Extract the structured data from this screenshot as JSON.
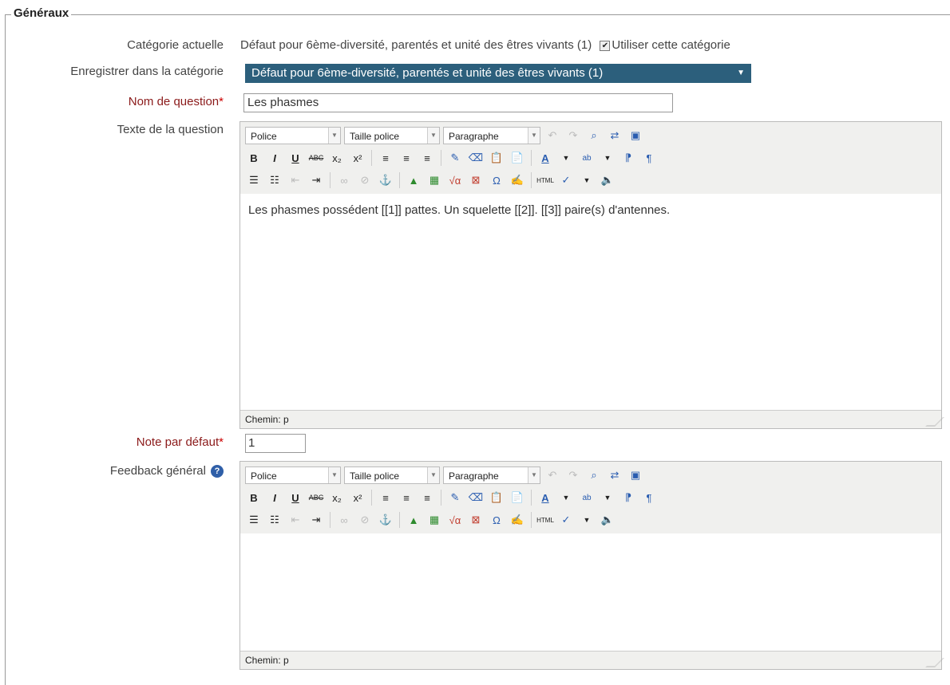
{
  "section": {
    "legend": "Généraux"
  },
  "labels": {
    "current_category": "Catégorie actuelle",
    "save_in_category": "Enregistrer dans la catégorie",
    "question_name": "Nom de question",
    "question_text": "Texte de la question",
    "default_mark": "Note par défaut",
    "general_feedback": "Feedback général",
    "required_marker": "*"
  },
  "current_category": {
    "value": "Défaut pour 6ème-diversité, parentés et unité des êtres vivants (1)",
    "use_this_category_label": "Utiliser cette catégorie",
    "use_this_category_checked": true
  },
  "save_category_select": {
    "selected": "Défaut pour 6ème-diversité, parentés et unité des êtres vivants (1)"
  },
  "question_name": {
    "value": "Les phasmes"
  },
  "default_mark": {
    "value": "1"
  },
  "editor": {
    "font_dropdown": "Police",
    "size_dropdown": "Taille police",
    "format_dropdown": "Paragraphe",
    "path_label": "Chemin: p",
    "icons": [
      "undo",
      "redo",
      "find",
      "replace",
      "fullscreen",
      "bold",
      "italic",
      "underline",
      "strikethrough",
      "subscript",
      "superscript",
      "align-left",
      "align-center",
      "align-right",
      "cleanup",
      "erase",
      "paste-text",
      "paste-word",
      "text-color",
      "highlight-color",
      "ltr",
      "rtl",
      "bullet-list",
      "numbered-list",
      "outdent",
      "indent",
      "link",
      "unlink",
      "anchor",
      "image",
      "media",
      "equation",
      "dragmath",
      "special-char",
      "template",
      "html",
      "spellcheck",
      "insert-sound"
    ]
  },
  "question_text": {
    "content": "Les phasmes possédent [[1]] pattes. Un squelette [[2]]. [[3]] paire(s) d'antennes."
  },
  "general_feedback": {
    "content": ""
  }
}
